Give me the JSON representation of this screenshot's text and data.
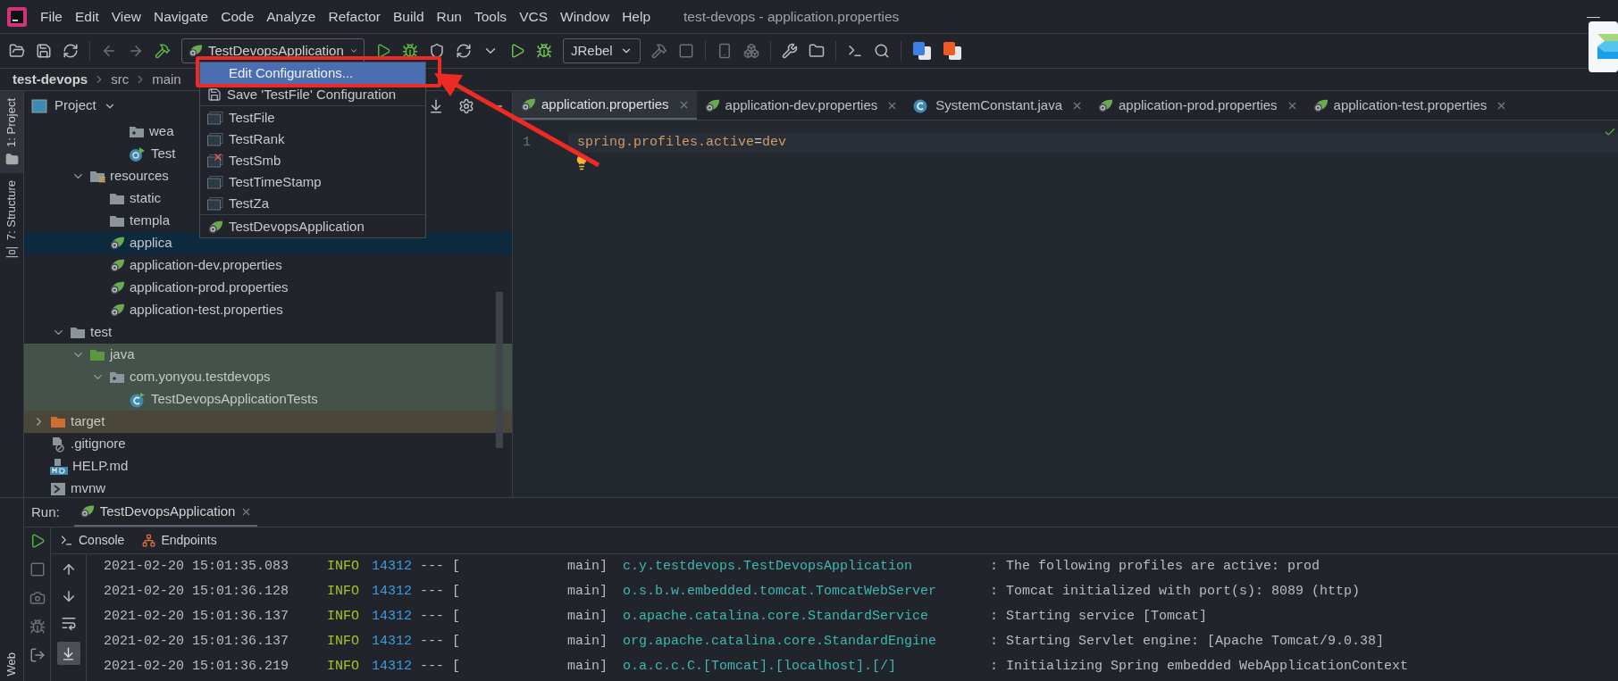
{
  "window": {
    "title": "test-devops - application.properties",
    "minimize": "—"
  },
  "menu": [
    "File",
    "Edit",
    "View",
    "Navigate",
    "Code",
    "Analyze",
    "Refactor",
    "Build",
    "Run",
    "Tools",
    "VCS",
    "Window",
    "Help"
  ],
  "toolbar": {
    "run_config": "TestDevopsApplication",
    "jrebel": "JRebel"
  },
  "breadcrumb": [
    "test-devops",
    "src",
    "main"
  ],
  "tool_strip": [
    {
      "label": "1: Project",
      "selected": true
    },
    {
      "label": "7: Structure",
      "selected": false
    }
  ],
  "tool_strip_bottom": "Web",
  "project": {
    "title": "Project",
    "tree": [
      {
        "children": [
          {
            "children": [
              {
                "children": [
                  {
                    "children": [
                      {
                        "label": "wea",
                        "kind": "package",
                        "selected": false
                      },
                      {
                        "label": "Test",
                        "kind": "spring-class",
                        "selected": false
                      }
                    ]
                  }
                ]
              },
              {
                "label": "resources",
                "kind": "resources-folder",
                "expanded": true,
                "selected": false,
                "children": [
                  {
                    "label": "static",
                    "kind": "folder",
                    "selected": false
                  },
                  {
                    "label": "templa",
                    "kind": "folder",
                    "selected": false
                  },
                  {
                    "label": "applica",
                    "kind": "spring-props",
                    "selected": true
                  },
                  {
                    "label": "application-dev.properties",
                    "kind": "spring-props",
                    "selected": false
                  },
                  {
                    "label": "application-prod.properties",
                    "kind": "spring-props",
                    "selected": false
                  },
                  {
                    "label": "application-test.properties",
                    "kind": "spring-props",
                    "selected": false
                  }
                ]
              }
            ]
          },
          {
            "label": "test",
            "kind": "folder",
            "expanded": true,
            "selected": false,
            "children": [
              {
                "label": "java",
                "kind": "test-folder",
                "color": "#45524a",
                "expanded": true,
                "selected": false,
                "children": [
                  {
                    "label": "com.yonyou.testdevops",
                    "kind": "package",
                    "color": "#45524a",
                    "expanded": true,
                    "selected": false,
                    "children": [
                      {
                        "label": "TestDevopsApplicationTests",
                        "kind": "test-class",
                        "color": "#45524a",
                        "selected": false
                      }
                    ]
                  }
                ]
              }
            ]
          }
        ]
      },
      {
        "label": "target",
        "kind": "excluded-folder",
        "color": "#4a4639",
        "expanded": false,
        "selected": false
      },
      {
        "label": ".gitignore",
        "kind": "ignore-file",
        "selected": false
      },
      {
        "label": "HELP.md",
        "kind": "markdown",
        "selected": false
      },
      {
        "label": "mvnw",
        "kind": "script",
        "selected": false
      }
    ]
  },
  "run_menu": {
    "groups": [
      [
        {
          "label": "Edit Configurations...",
          "kind": "action",
          "selected": true
        },
        {
          "label": "Save 'TestFile' Configuration",
          "kind": "save",
          "selected": false
        }
      ],
      [
        {
          "label": "TestFile",
          "kind": "app",
          "selected": false
        },
        {
          "label": "TestRank",
          "kind": "app",
          "selected": false
        },
        {
          "label": "TestSmb",
          "kind": "app-error",
          "selected": false
        },
        {
          "label": "TestTimeStamp",
          "kind": "app",
          "selected": false
        },
        {
          "label": "TestZa",
          "kind": "app",
          "selected": false
        }
      ],
      [
        {
          "label": "TestDevopsApplication",
          "kind": "spring",
          "selected": false
        }
      ]
    ]
  },
  "editor": {
    "tabs": [
      {
        "label": "application.properties",
        "kind": "spring-props",
        "selected": true
      },
      {
        "label": "application-dev.properties",
        "kind": "spring-props",
        "selected": false
      },
      {
        "label": "SystemConstant.java",
        "kind": "java-class",
        "selected": false
      },
      {
        "label": "application-prod.properties",
        "kind": "spring-props",
        "selected": false
      },
      {
        "label": "application-test.properties",
        "kind": "spring-props",
        "selected": false
      }
    ],
    "lines": [
      {
        "number": "1",
        "key": "spring.profiles.active",
        "sep": "=",
        "value": "dev"
      }
    ]
  },
  "run": {
    "label": "Run:",
    "tab": {
      "label": "TestDevopsApplication",
      "selected": true
    },
    "console_tabs": [
      "Console",
      "Endpoints"
    ],
    "logs": [
      {
        "time": "2021-02-20 15:01:35.083",
        "level": "INFO",
        "pid": "14312",
        "sep": "--- [",
        "thread": "main]",
        "logger": "c.y.testdevops.TestDevopsApplication",
        "message": ": The following profiles are active: prod"
      },
      {
        "time": "2021-02-20 15:01:36.128",
        "level": "INFO",
        "pid": "14312",
        "sep": "--- [",
        "thread": "main]",
        "logger": "o.s.b.w.embedded.tomcat.TomcatWebServer",
        "message": ": Tomcat initialized with port(s): 8089 (http)"
      },
      {
        "time": "2021-02-20 15:01:36.137",
        "level": "INFO",
        "pid": "14312",
        "sep": "--- [",
        "thread": "main]",
        "logger": "o.apache.catalina.core.StandardService",
        "message": ": Starting service [Tomcat]"
      },
      {
        "time": "2021-02-20 15:01:36.137",
        "level": "INFO",
        "pid": "14312",
        "sep": "--- [",
        "thread": "main]",
        "logger": "org.apache.catalina.core.StandardEngine",
        "message": ": Starting Servlet engine: [Apache Tomcat/9.0.38]"
      },
      {
        "time": "2021-02-20 15:01:36.219",
        "level": "INFO",
        "pid": "14312",
        "sep": "--- [",
        "thread": "main]",
        "logger": "o.a.c.c.C.[Tomcat].[localhost].[/]",
        "message": ": Initializing Spring embedded WebApplicationContext"
      }
    ]
  }
}
